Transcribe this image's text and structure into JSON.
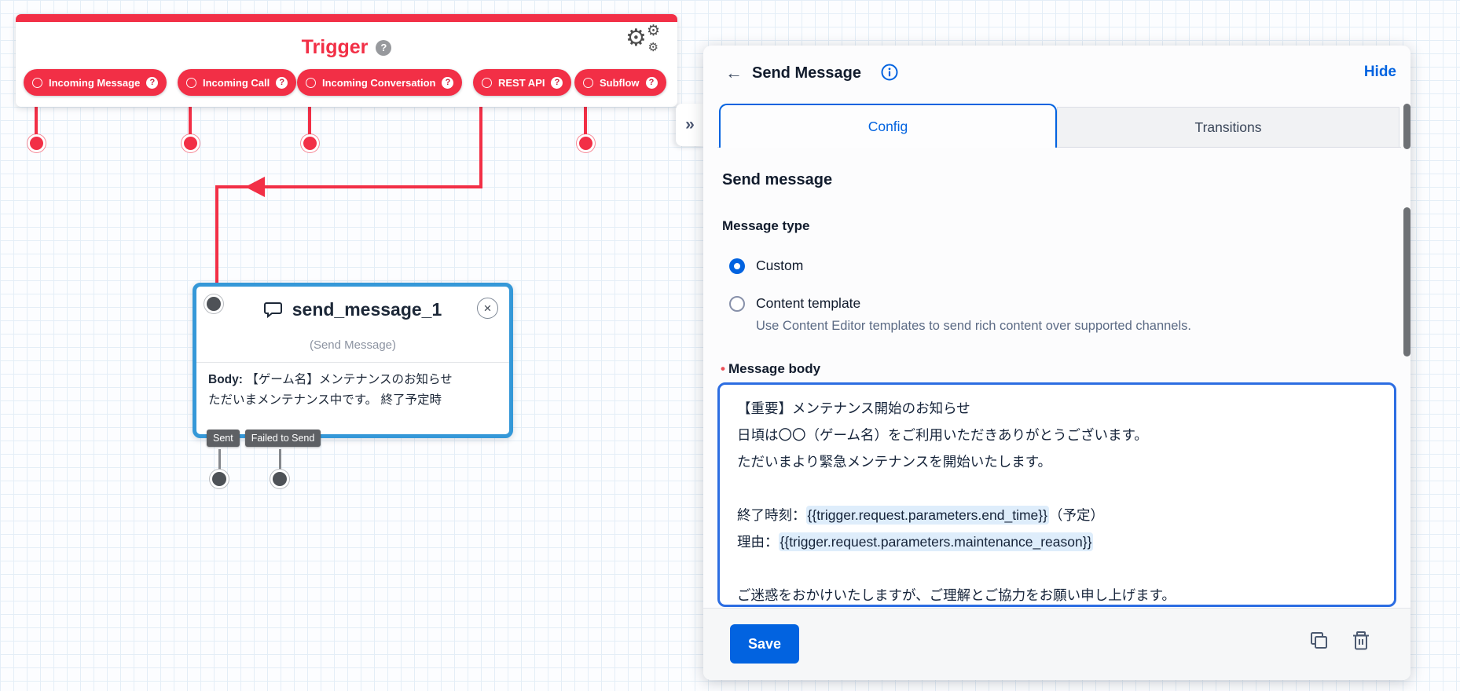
{
  "colors": {
    "accent_red": "#f22f46",
    "accent_blue": "#0263e0",
    "widget_selected_border": "#3598d8",
    "token_highlight": "#deedfb"
  },
  "icons": {
    "collapse": "»",
    "back": "←",
    "close": "×",
    "help": "?",
    "gear": "⚙",
    "required_marker": "•"
  },
  "canvas": {
    "trigger": {
      "title": "Trigger",
      "pills": [
        {
          "label": "Incoming Message"
        },
        {
          "label": "Incoming Call"
        },
        {
          "label": "Incoming Conversation"
        },
        {
          "label": "REST API"
        },
        {
          "label": "Subflow"
        }
      ]
    },
    "widget": {
      "name": "send_message_1",
      "type_label": "(Send Message)",
      "body_label": "Body:",
      "body_line1": "【ゲーム名】メンテナンスのお知らせ",
      "body_line2": "ただいまメンテナンス中です。 終了予定時",
      "transitions": [
        {
          "label": "Sent"
        },
        {
          "label": "Failed to Send"
        }
      ]
    }
  },
  "panel": {
    "title": "Send Message",
    "hide_label": "Hide",
    "tabs": [
      {
        "label": "Config"
      },
      {
        "label": "Transitions"
      }
    ],
    "heading": "Send message",
    "message_type": {
      "label": "Message type",
      "options": [
        {
          "label": "Custom",
          "selected": true
        },
        {
          "label": "Content template",
          "selected": false,
          "help": "Use Content Editor templates to send rich content over supported channels."
        }
      ]
    },
    "message_body": {
      "label": "Message body",
      "content": [
        [
          {
            "t": "【重要】メンテナンス開始のお知らせ"
          }
        ],
        [
          {
            "t": "日頃は〇〇（ゲーム名）をご利用いただきありがとうございます。"
          }
        ],
        [
          {
            "t": "ただいまより緊急メンテナンスを開始いたします。"
          }
        ],
        [],
        [
          {
            "t": "終了時刻："
          },
          {
            "t": "{{trigger.request.parameters.end_time}}",
            "hl": true
          },
          {
            "t": "（予定）"
          }
        ],
        [
          {
            "t": "理由："
          },
          {
            "t": "{{trigger.request.parameters.maintenance_reason}}",
            "hl": true
          }
        ],
        [],
        [
          {
            "t": "ご迷惑をおかけいたしますが、ご理解とご協力をお願い申し上げます。"
          }
        ]
      ]
    },
    "save_label": "Save"
  }
}
